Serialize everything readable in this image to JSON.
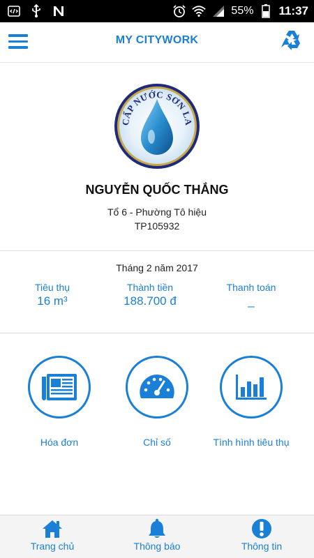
{
  "status_bar": {
    "battery": "55%",
    "time": "11:37"
  },
  "app_bar": {
    "title": "MY CITYWORK"
  },
  "logo": {
    "text": "CẤP NƯỚC SƠN LA"
  },
  "customer": {
    "name": "NGUYỄN QUỐC THẮNG",
    "address": "Tổ 6 - Phường Tô hiệu",
    "code": "TP105932"
  },
  "billing": {
    "period": "Tháng 2 năm 2017",
    "consumption_label": "Tiêu thụ",
    "consumption_value": "16 m³",
    "amount_label": "Thành tiền",
    "amount_value": "188.700 đ",
    "payment_label": "Thanh toán",
    "payment_value": "_"
  },
  "features": [
    {
      "label": "Hóa đơn",
      "icon": "newspaper-icon"
    },
    {
      "label": "Chỉ số",
      "icon": "gauge-icon"
    },
    {
      "label": "Tình hình tiêu thụ",
      "icon": "bar-chart-icon"
    }
  ],
  "bottom_nav": [
    {
      "label": "Trang chủ",
      "icon": "home-icon"
    },
    {
      "label": "Thông báo",
      "icon": "bell-icon"
    },
    {
      "label": "Thông tin",
      "icon": "info-icon"
    }
  ],
  "colors": {
    "accent": "#1a7fd6",
    "logo_ring": "#1f2a7a",
    "water_drop": "#2a8fd0"
  }
}
